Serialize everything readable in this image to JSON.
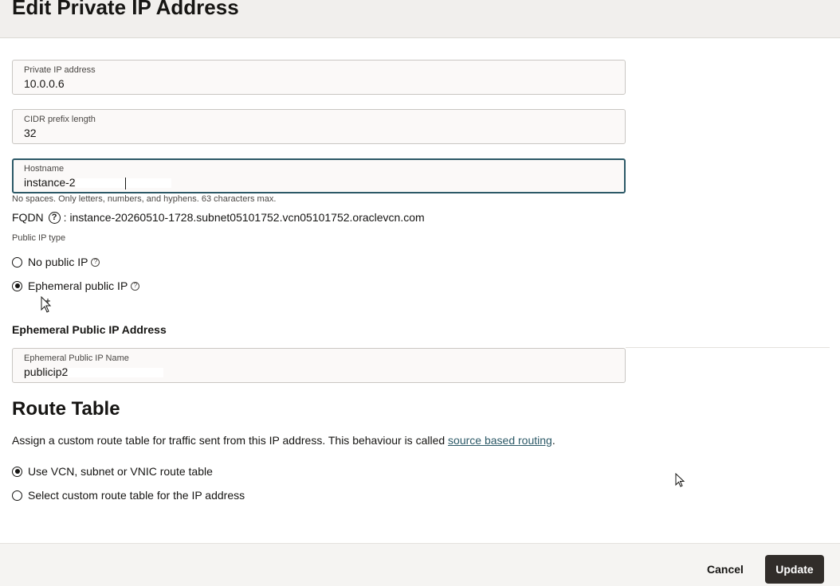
{
  "header": {
    "title": "Edit Private IP Address"
  },
  "fields": {
    "private_ip": {
      "label": "Private IP address",
      "value": "10.0.0.6"
    },
    "cidr": {
      "label": "CIDR prefix length",
      "value": "32"
    },
    "hostname": {
      "label": "Hostname",
      "value": "instance-2"
    },
    "ephemeral_name": {
      "label": "Ephemeral Public IP Name",
      "value": "publicip2"
    }
  },
  "hostname_helper": "No spaces. Only letters, numbers, and hyphens. 63 characters max.",
  "fqdn": {
    "label": "FQDN",
    "value": ": instance-20260510-1728.subnet05101752.vcn05101752.oraclevcn.com"
  },
  "public_ip_type": {
    "label": "Public IP type",
    "options": [
      {
        "label": "No public IP",
        "checked": false
      },
      {
        "label": "Ephemeral public IP",
        "checked": true
      }
    ]
  },
  "ephemeral_address": {
    "label": "Ephemeral Public IP Address"
  },
  "route_table": {
    "title": "Route Table",
    "description": "Assign a custom route table for traffic sent from this IP address. This behaviour is called ",
    "link": "source based routing",
    "period": ".",
    "options": [
      {
        "label": "Use VCN, subnet or VNIC route table",
        "checked": true
      },
      {
        "label": "Select custom route table for the IP address",
        "checked": false
      }
    ]
  },
  "footer": {
    "cancel": "Cancel",
    "update": "Update"
  },
  "icons": {
    "help": "question-circle-icon",
    "cursor": "mouse-pointer-icon"
  }
}
